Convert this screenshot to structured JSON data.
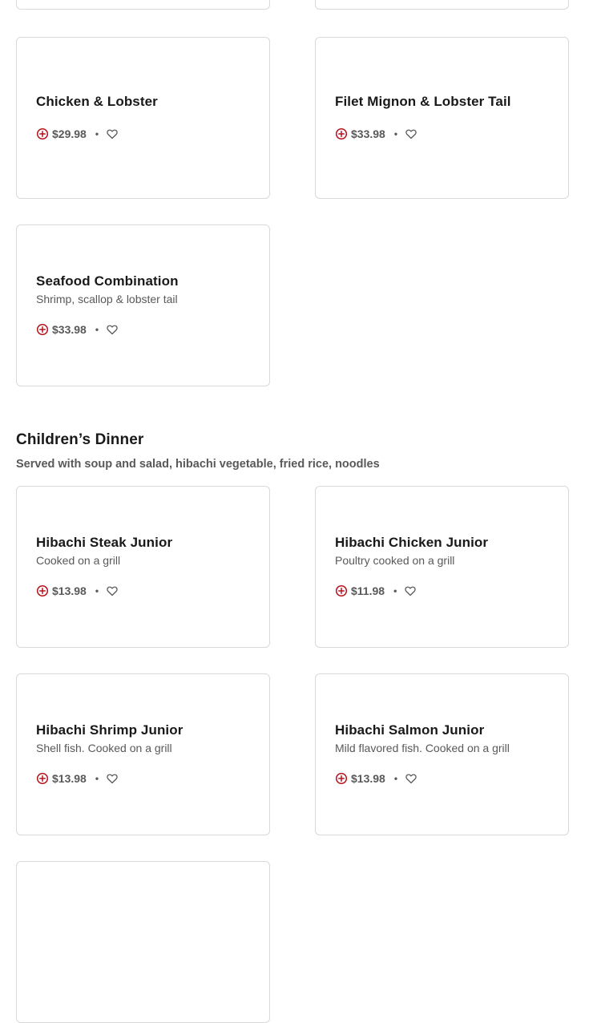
{
  "colors": {
    "accent": "#b5121b",
    "text_primary": "#191919",
    "text_secondary": "#595959",
    "border": "#d9d9d9"
  },
  "icons": {
    "add": "add-circle-icon",
    "favorite": "heart-outline-icon"
  },
  "separator": "•",
  "section_above": {
    "items": [
      {
        "name": "Chicken & Lobster",
        "description": "",
        "price": "$29.98"
      },
      {
        "name": "Filet Mignon & Lobster Tail",
        "description": "",
        "price": "$33.98"
      },
      {
        "name": "Seafood Combination",
        "description": "Shrimp, scallop & lobster tail",
        "price": "$33.98"
      }
    ]
  },
  "childrens_dinner": {
    "title": "Children’s Dinner",
    "subtitle": "Served with soup and salad, hibachi vegetable, fried rice, noodles",
    "items": [
      {
        "name": "Hibachi Steak Junior",
        "description": "Cooked on a grill",
        "price": "$13.98"
      },
      {
        "name": "Hibachi Chicken Junior",
        "description": "Poultry cooked on a grill",
        "price": "$11.98"
      },
      {
        "name": "Hibachi Shrimp Junior",
        "description": "Shell fish. Cooked on a grill",
        "price": "$13.98"
      },
      {
        "name": "Hibachi Salmon Junior",
        "description": "Mild flavored fish. Cooked on a grill",
        "price": "$13.98"
      }
    ]
  }
}
